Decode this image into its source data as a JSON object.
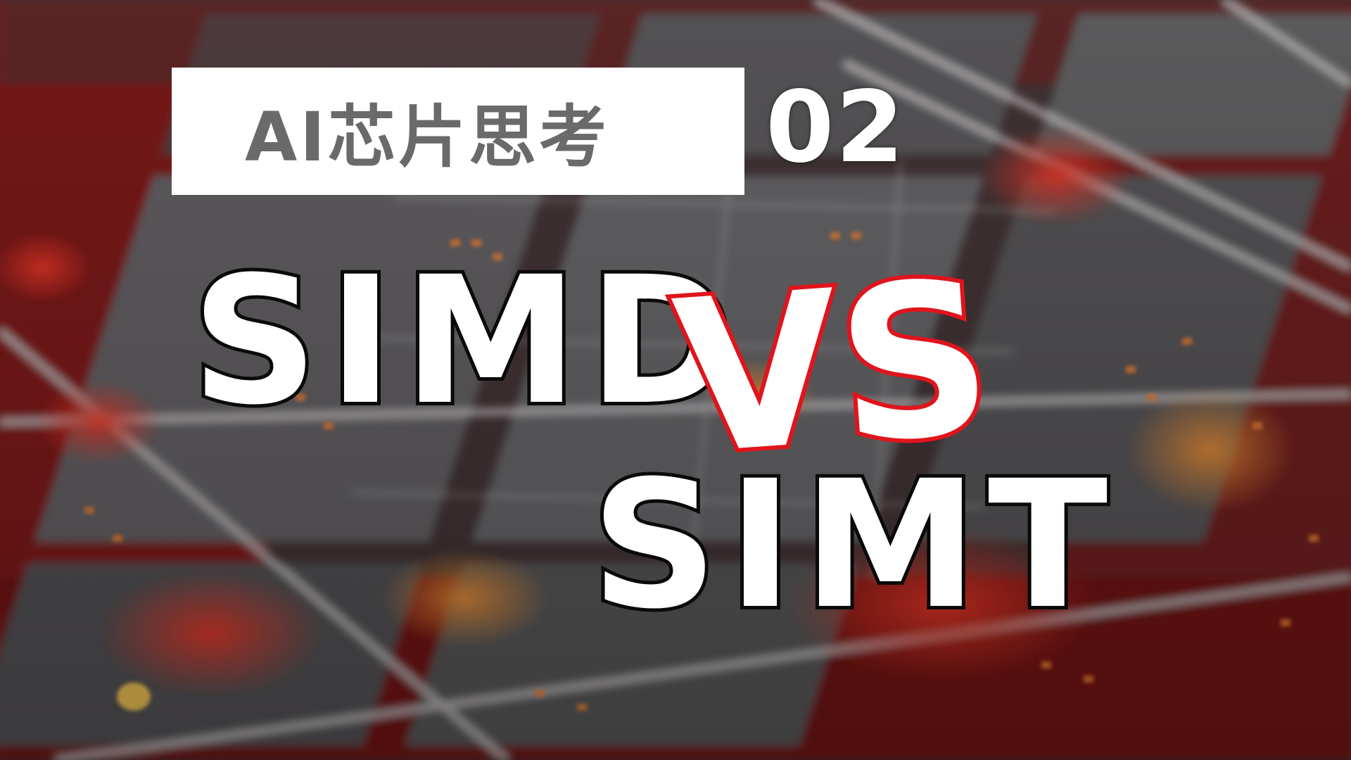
{
  "title_label": "AI芯片思考",
  "episode_number": "02",
  "left_word": "SIMD",
  "vs_text": "VS",
  "right_word": "SIMT",
  "colors": {
    "vs_outline": "#e0141c",
    "title_text": "#6a6a6a",
    "background_red": "#c81e1e",
    "background_gray": "#5a5a5e"
  }
}
